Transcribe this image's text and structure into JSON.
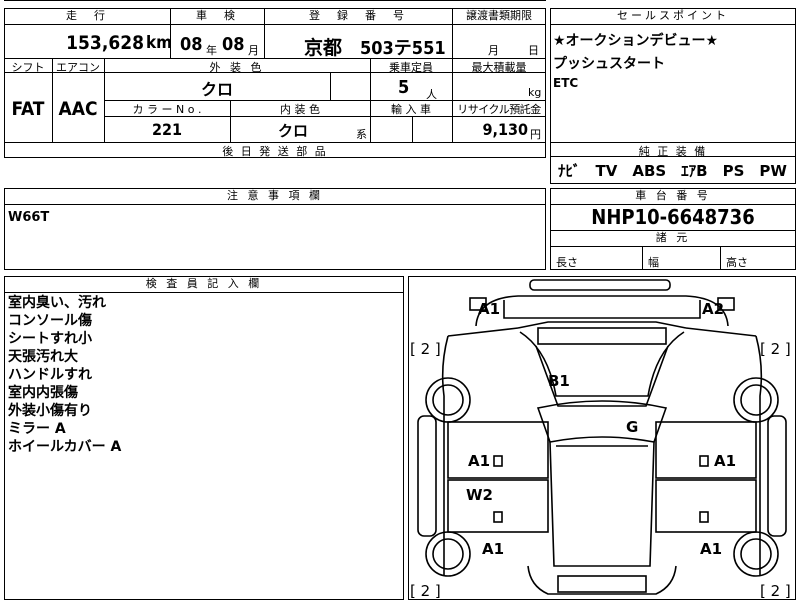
{
  "header": {
    "mileage_label": "走　行",
    "inspection_label": "車　検",
    "registration_label": "登　録　番　号",
    "transfer_doc_label": "譲渡書類期限",
    "sales_point_label": "セールスポイント"
  },
  "values": {
    "mileage": "153,628",
    "mileage_unit": "km",
    "inspection_year": "08",
    "year_unit": "年",
    "inspection_month": "08",
    "month_unit": "月",
    "registration_area": "京都",
    "registration_number": "503テ551",
    "transfer_month_unit": "月",
    "transfer_day_unit": "日"
  },
  "row2": {
    "shift_label": "シフト",
    "aircon_label": "エアコン",
    "exterior_color_label": "外 装 色",
    "capacity_label": "乗車定員",
    "max_load_label": "最大積載量",
    "shift": "FAT",
    "aircon": "AAC",
    "exterior_color": "クロ",
    "capacity": "5",
    "capacity_unit": "人",
    "load_unit": "kg",
    "color_no_label": "カ ラ ー  N o .",
    "interior_color_label": "内 装 色",
    "import_label": "輸 入 車",
    "recycle_label": "リサイクル預託金",
    "color_no": "221",
    "interior_color": "クロ",
    "interior_suffix": "系",
    "recycle_amount": "9,130",
    "recycle_unit": "円",
    "later_parts_label": "後 日 発 送 部 品"
  },
  "sales_points": {
    "line1": "★オークションデビュー★",
    "line2": "プッシュスタート",
    "line3": "ETC"
  },
  "equipment": {
    "label": "純 正 装 備",
    "items": "ﾅﾋﾞ　TV　ABS　ｴｱB　PS　PW"
  },
  "notes": {
    "label": "注 意 事 項 欄",
    "text": "W66T"
  },
  "chassis": {
    "label": "車 台 番 号",
    "number": "NHP10-6648736"
  },
  "dimensions": {
    "label": "諸 元",
    "length_label": "長さ",
    "width_label": "幅",
    "height_label": "高さ"
  },
  "inspector": {
    "label": "検 査 員 記 入 欄",
    "lines": [
      "室内臭い、汚れ",
      "コンソール傷",
      "シートすれ小",
      "天張汚れ大",
      "ハンドルすれ",
      "室内内張傷",
      "外装小傷有り",
      "ミラー A",
      "ホイールカバー A"
    ]
  },
  "damage_map": {
    "marks": [
      "A1",
      "A2",
      "B1",
      "G",
      "A1",
      "A1",
      "W2",
      "A1",
      "A1"
    ],
    "tire_marks": [
      "[ 2 ]",
      "[ 2 ]",
      "[ 2 ]",
      "[ 2 ]"
    ]
  }
}
